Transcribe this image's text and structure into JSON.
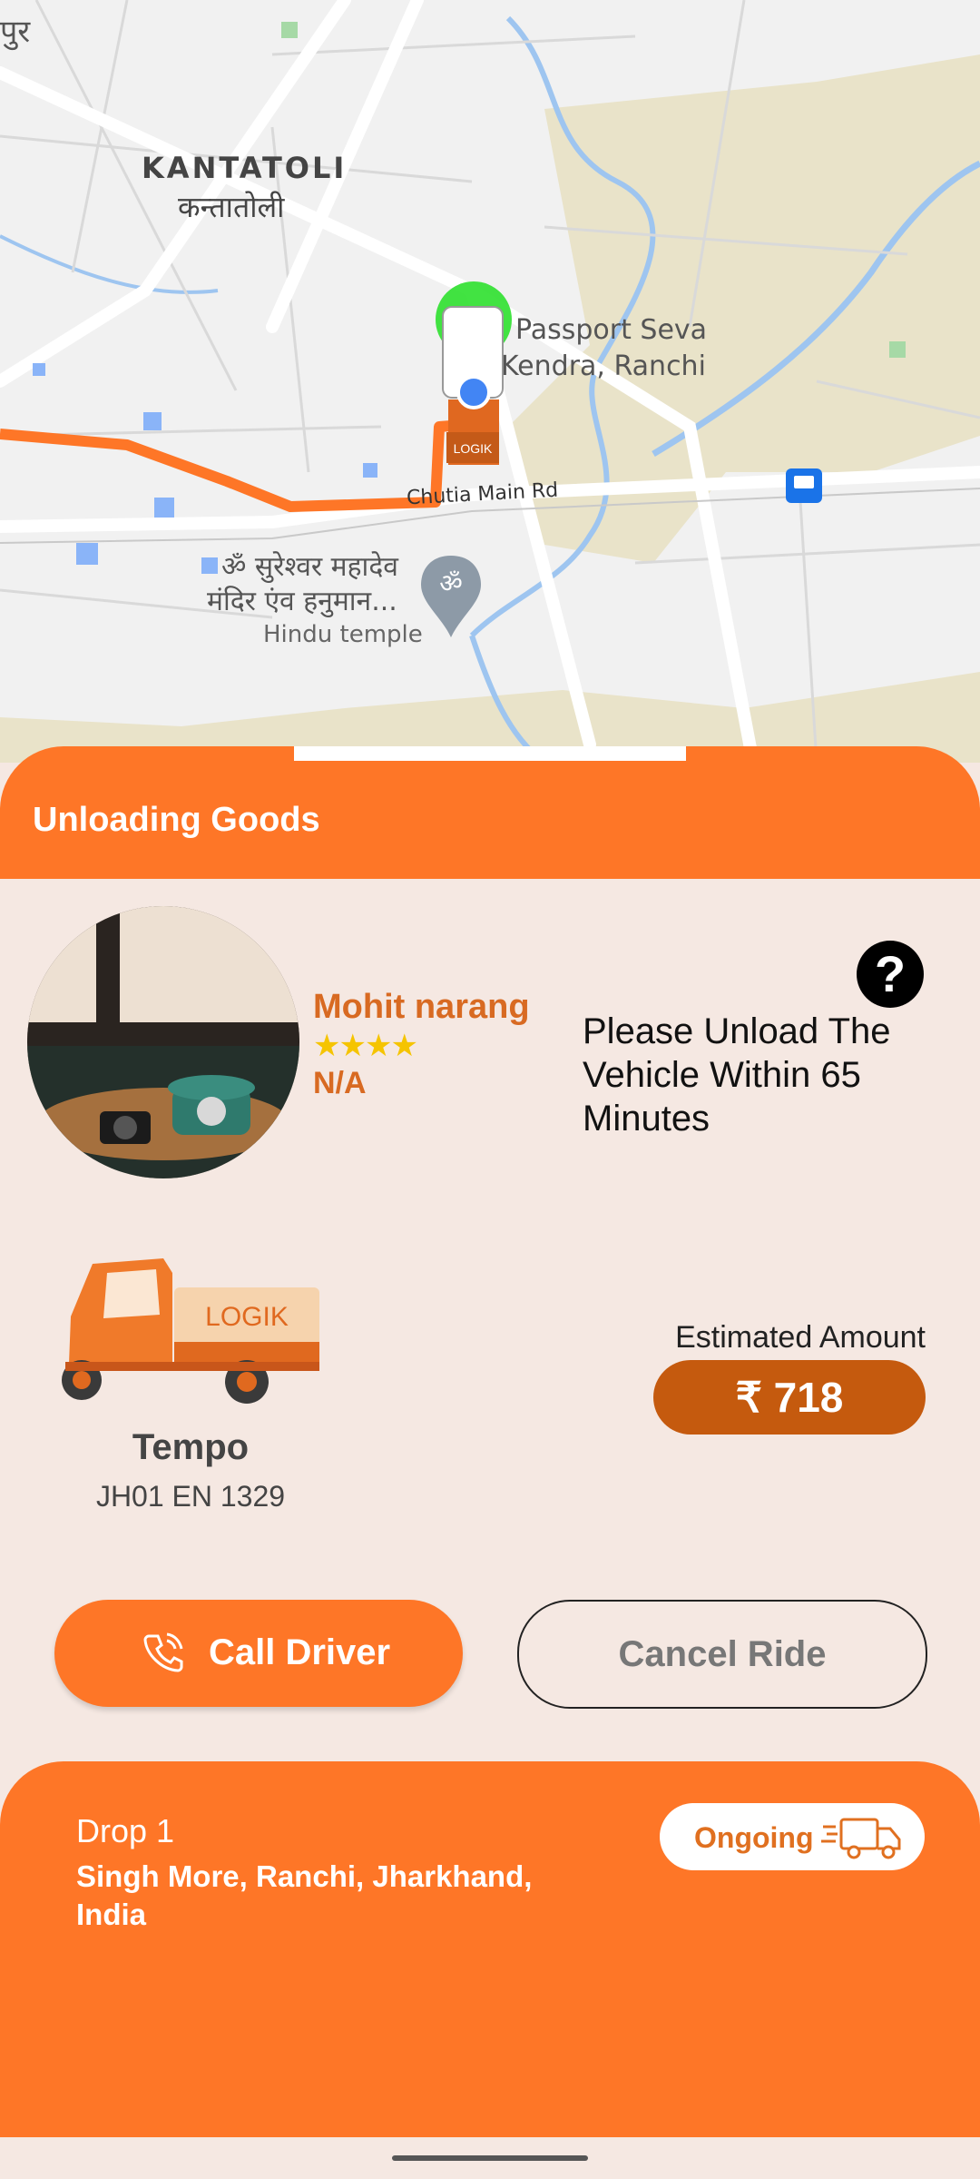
{
  "map": {
    "labels": {
      "corner": "पुर",
      "kantatoli_en": "KANTATOLI",
      "kantatoli_hi": "कन्तातोली",
      "passport_1": "Passport Seva",
      "passport_2": "Kendra, Ranchi",
      "road": "Chutia Main Rd",
      "temple_1": "ॐ सुरेश्वर महादेव",
      "temple_2": "मंदिर एंव हनुमान...",
      "temple_3": "Hindu temple",
      "truck_brand": "LOGIK"
    },
    "colors": {
      "route": "#fe7627",
      "water": "#9ec5f0",
      "park": "#e9e3c9"
    }
  },
  "header": {
    "title": "Unloading Goods"
  },
  "driver": {
    "name": "Mohit narang",
    "stars": "★★★★",
    "rating": 4,
    "subtitle": "N/A"
  },
  "instruction": {
    "text": "Please Unload The Vehicle Within 65 Minutes",
    "help_icon": "question-circle-icon",
    "help_glyph": "?"
  },
  "vehicle": {
    "type": "Tempo",
    "plate": "JH01 EN 1329",
    "brand": "LOGIK"
  },
  "estimate": {
    "label": "Estimated Amount",
    "amount": "₹ 718"
  },
  "actions": {
    "call_label": "Call Driver",
    "call_icon": "phone-icon",
    "cancel_label": "Cancel Ride"
  },
  "drop": {
    "title": "Drop 1",
    "address": "Singh More, Ranchi, Jharkhand, India",
    "status": "Ongoing",
    "status_icon": "delivery-truck-icon"
  },
  "theme": {
    "accent": "#fe7627",
    "amount_bg": "#c55a0e",
    "sheet_bg": "#f5e8e2"
  }
}
